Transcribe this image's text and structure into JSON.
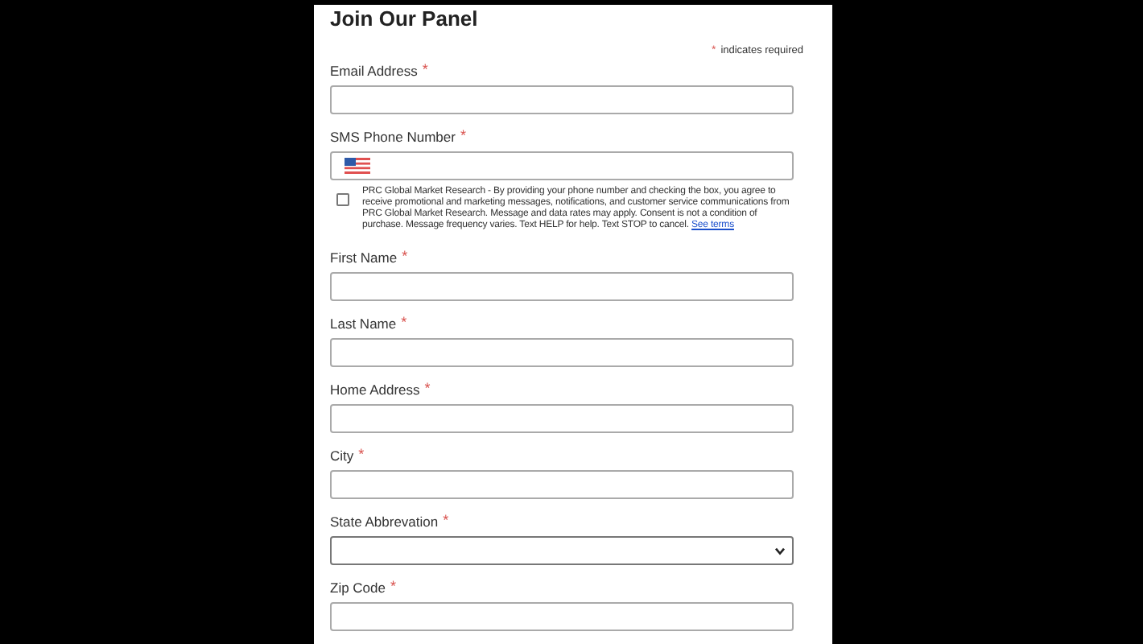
{
  "form": {
    "title": "Join Our Panel",
    "required_note": {
      "mark": "*",
      "text": "indicates required"
    },
    "fields": [
      {
        "kind": "text",
        "label": "Email Address",
        "required_mark": "*"
      },
      {
        "kind": "phone",
        "label": "SMS Phone Number",
        "required_mark": "*"
      },
      {
        "kind": "consent",
        "checked": false,
        "text": "PRC Global Market Research - By providing your phone number and checking the box, you agree to receive promotional and marketing messages, notifications, and customer service communications from PRC Global Market Research. Message and data rates may apply. Consent is not a condition of purchase. Message frequency varies. Text HELP for help. Text STOP to cancel.",
        "link": "See terms"
      },
      {
        "kind": "text",
        "label": "First Name",
        "required_mark": "*"
      },
      {
        "kind": "text",
        "label": "Last Name",
        "required_mark": "*"
      },
      {
        "kind": "text",
        "label": "Home Address",
        "required_mark": "*"
      },
      {
        "kind": "text",
        "label": "City",
        "required_mark": "*"
      },
      {
        "kind": "select",
        "label": "State Abbrevation",
        "required_mark": "*"
      },
      {
        "kind": "text",
        "label": "Zip Code",
        "required_mark": "*"
      }
    ]
  }
}
